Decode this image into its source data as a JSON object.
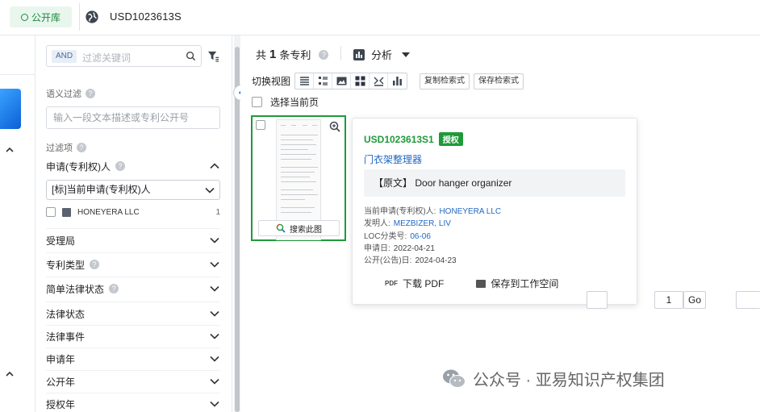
{
  "topbar": {
    "library_label": "公开库",
    "query": "USD1023613S"
  },
  "sidebar": {
    "and_tag": "AND",
    "keyword_placeholder": "过滤关键词",
    "semantic_label": "语义过滤",
    "semantic_placeholder": "输入一段文本描述或专利公开号",
    "filter_items_label": "过滤项",
    "applicant_group": "申请(专利权)人",
    "applicant_select": "[标]当前申请(专利权)人",
    "applicant_option": "HONEYERA LLC",
    "applicant_count": "1",
    "groups": [
      "受理局",
      "专利类型",
      "简单法律状态",
      "法律状态",
      "法律事件",
      "申请年",
      "公开年",
      "授权年"
    ]
  },
  "main": {
    "count_prefix": "共",
    "count": "1",
    "count_suffix": "条专利",
    "analysis": "分析",
    "switch_view": "切换视图",
    "copy_query": "复制检索式",
    "save_query": "保存检索式",
    "select_page": "选择当前页",
    "search_this": "搜索此图",
    "pager_value": "1",
    "pager_go": "Go"
  },
  "popup": {
    "number": "USD1023613S1",
    "badge": "授权",
    "title": "门衣架整理器",
    "original_prefix": "【原文】",
    "original_title": "Door hanger organizer",
    "meta": [
      {
        "label": "当前申请(专利权)人:",
        "value": "HONEYERA LLC",
        "link": true
      },
      {
        "label": "发明人:",
        "value": "MEZBIZER, LIV",
        "link": true
      },
      {
        "label": "LOC分类号:",
        "value": "06-06",
        "link": true
      },
      {
        "label": "申请日:",
        "value": "2022-04-21",
        "link": false
      },
      {
        "label": "公开(公告)日:",
        "value": "2024-04-23",
        "link": false
      }
    ],
    "pdf_icon": "PDF",
    "download_pdf": "下载 PDF",
    "save_workspace": "保存到工作空间"
  },
  "watermark": "公众号 · 亚易知识产权集团",
  "colors": {
    "accent_green": "#1f9a39",
    "link_blue": "#2168c4"
  }
}
